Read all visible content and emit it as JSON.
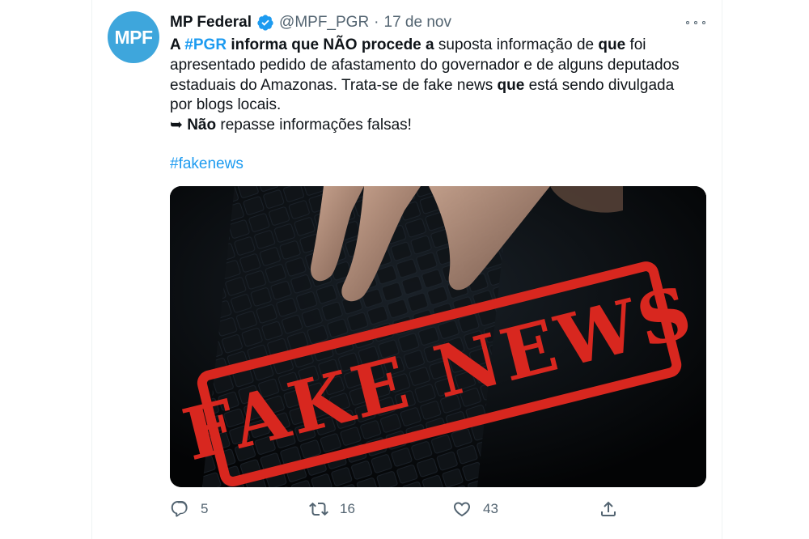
{
  "tweet": {
    "avatar_text": "MPF",
    "author_name": "MP Federal",
    "handle": "@MPF_PGR",
    "separator": "·",
    "date": "17 de nov",
    "body": {
      "p1": "A ",
      "p2": "#PGR",
      "p3": " informa que NÃO procede a",
      "p4": " suposta informação de ",
      "p5": "que",
      "p6": " foi apresentado pedido de afastamento do governador e de alguns deputados estaduais do Amazonas. Trata-se de fake news ",
      "p7": "que",
      "p8": " está sendo divulgada por blogs locais.",
      "p9": "➥ ",
      "p10": "Não",
      "p11": " repasse informações falsas!"
    },
    "hashtag": "#fakenews",
    "image_stamp": "FAKE NEWS",
    "stats": {
      "replies": "5",
      "retweets": "16",
      "likes": "43"
    },
    "colors": {
      "link": "#1d9bf0",
      "avatar": "#3ea6dc",
      "stamp": "#d8271f",
      "muted": "#536471"
    },
    "icons": [
      "verified-badge-icon",
      "more-options-icon",
      "reply-icon",
      "retweet-icon",
      "like-icon",
      "share-icon"
    ]
  }
}
